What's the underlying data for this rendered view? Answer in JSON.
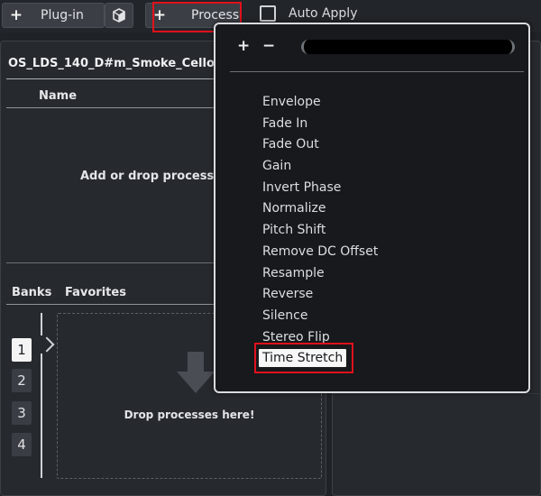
{
  "toolbar": {
    "plugin_label": "Plug-in",
    "process_label": "Process",
    "auto_apply_label": "Auto Apply",
    "plus_glyph": "+",
    "cube_icon": "cube-icon"
  },
  "left_panel": {
    "file_name": "OS_LDS_140_D#m_Smoke_Cello",
    "name_column": "Name",
    "drop_hint": "Add or drop processes",
    "tabs": [
      "Banks",
      "Favorites"
    ],
    "banks": [
      "1",
      "2",
      "3",
      "4"
    ],
    "active_bank": "1",
    "dropzone_text": "Drop processes here!"
  },
  "popup": {
    "add_glyph": "+",
    "remove_glyph": "−",
    "items": [
      "Envelope",
      "Fade In",
      "Fade Out",
      "Gain",
      "Invert Phase",
      "Normalize",
      "Pitch Shift",
      "Remove DC Offset",
      "Resample",
      "Reverse",
      "Silence",
      "Stereo Flip",
      "Time Stretch"
    ],
    "selected": "Time Stretch"
  },
  "colors": {
    "highlight": "#e0111b",
    "background": "#1f2226",
    "panel": "#26292e",
    "popup": "#17191c"
  }
}
